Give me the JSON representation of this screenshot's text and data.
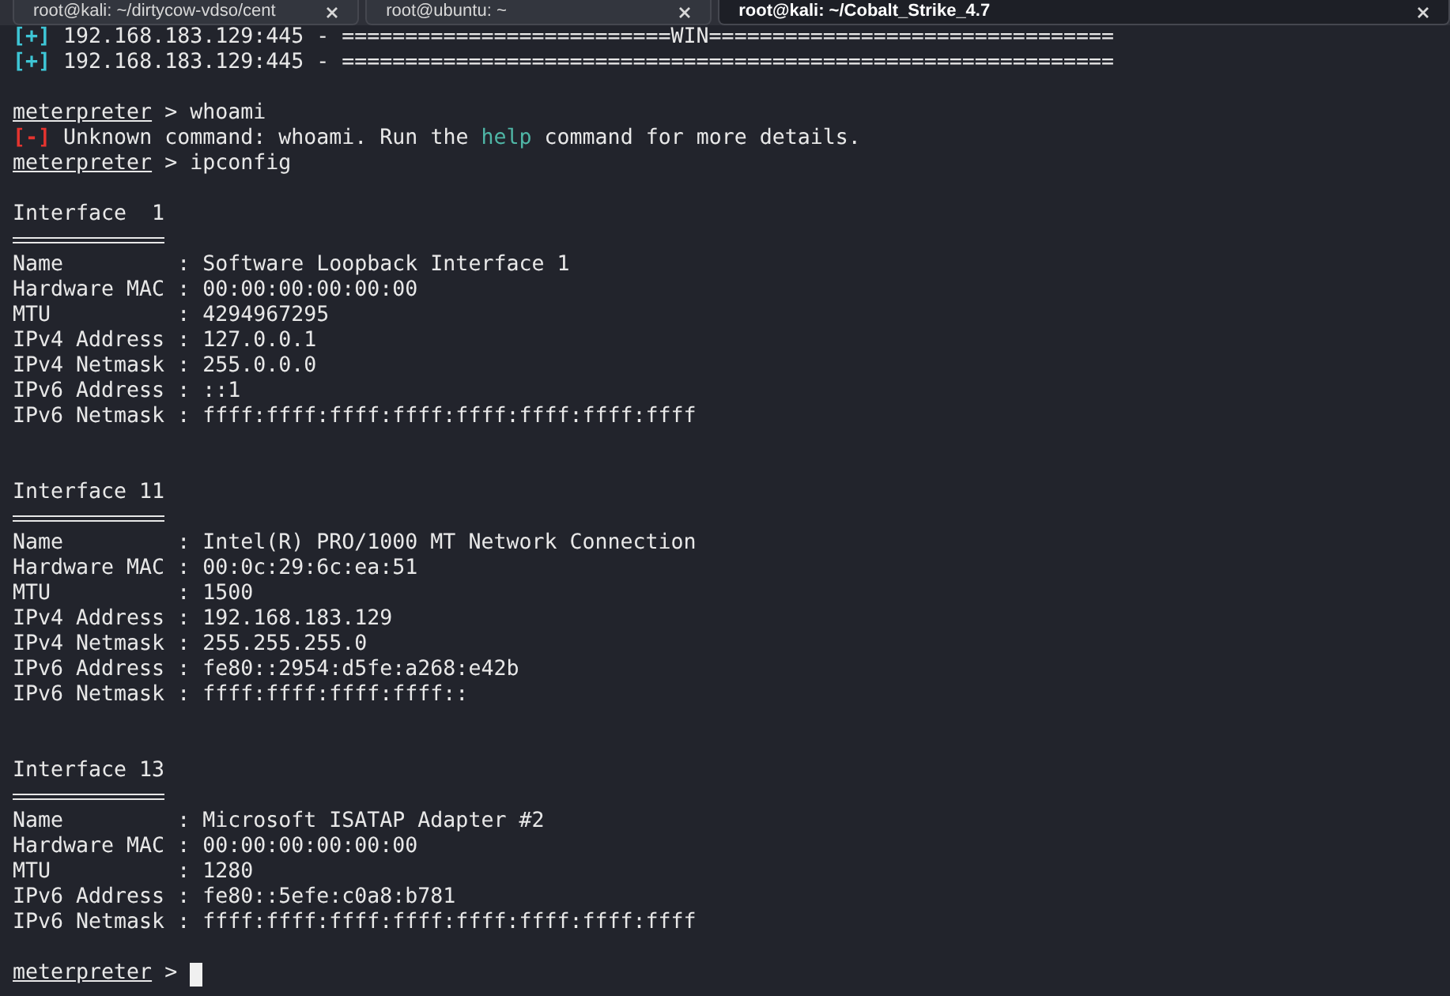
{
  "tabs": [
    {
      "title": "root@kali: ~/dirtycow-vdso/cent",
      "selected": false
    },
    {
      "title": "root@ubuntu: ~",
      "selected": false
    },
    {
      "title": "root@kali: ~/Cobalt_Strike_4.7",
      "selected": true
    }
  ],
  "lines": [
    {
      "kind": "status",
      "mark": "[+]",
      "text": "192.168.183.129:445 - ==========================WIN================================"
    },
    {
      "kind": "status",
      "mark": "[+]",
      "text": "192.168.183.129:445 - ============================================================="
    },
    {
      "kind": "blank"
    },
    {
      "kind": "prompt",
      "prompt": "meterpreter",
      "symbol": ">",
      "command": "whoami",
      "cursor": false
    },
    {
      "kind": "error",
      "mark": "[-]",
      "before": "Unknown command: whoami. Run the",
      "keyword": "help",
      "after": "command for more details."
    },
    {
      "kind": "prompt",
      "prompt": "meterpreter",
      "symbol": ">",
      "command": "ipconfig",
      "cursor": false
    },
    {
      "kind": "blank"
    },
    {
      "kind": "heading",
      "text": "Interface  1"
    },
    {
      "kind": "field",
      "label": "Name",
      "separator": ":",
      "value": "Software Loopback Interface 1"
    },
    {
      "kind": "field",
      "label": "Hardware MAC",
      "separator": ":",
      "value": "00:00:00:00:00:00"
    },
    {
      "kind": "field",
      "label": "MTU",
      "separator": ":",
      "value": "4294967295"
    },
    {
      "kind": "field",
      "label": "IPv4 Address",
      "separator": ":",
      "value": "127.0.0.1"
    },
    {
      "kind": "field",
      "label": "IPv4 Netmask",
      "separator": ":",
      "value": "255.0.0.0"
    },
    {
      "kind": "field",
      "label": "IPv6 Address",
      "separator": ":",
      "value": "::1"
    },
    {
      "kind": "field",
      "label": "IPv6 Netmask",
      "separator": ":",
      "value": "ffff:ffff:ffff:ffff:ffff:ffff:ffff:ffff"
    },
    {
      "kind": "blank"
    },
    {
      "kind": "blank"
    },
    {
      "kind": "heading",
      "text": "Interface 11"
    },
    {
      "kind": "field",
      "label": "Name",
      "separator": ":",
      "value": "Intel(R) PRO/1000 MT Network Connection"
    },
    {
      "kind": "field",
      "label": "Hardware MAC",
      "separator": ":",
      "value": "00:0c:29:6c:ea:51"
    },
    {
      "kind": "field",
      "label": "MTU",
      "separator": ":",
      "value": "1500"
    },
    {
      "kind": "field",
      "label": "IPv4 Address",
      "separator": ":",
      "value": "192.168.183.129"
    },
    {
      "kind": "field",
      "label": "IPv4 Netmask",
      "separator": ":",
      "value": "255.255.255.0"
    },
    {
      "kind": "field",
      "label": "IPv6 Address",
      "separator": ":",
      "value": "fe80::2954:d5fe:a268:e42b"
    },
    {
      "kind": "field",
      "label": "IPv6 Netmask",
      "separator": ":",
      "value": "ffff:ffff:ffff:ffff::"
    },
    {
      "kind": "blank"
    },
    {
      "kind": "blank"
    },
    {
      "kind": "heading",
      "text": "Interface 13"
    },
    {
      "kind": "field",
      "label": "Name",
      "separator": ":",
      "value": "Microsoft ISATAP Adapter #2"
    },
    {
      "kind": "field",
      "label": "Hardware MAC",
      "separator": ":",
      "value": "00:00:00:00:00:00"
    },
    {
      "kind": "field",
      "label": "MTU",
      "separator": ":",
      "value": "1280"
    },
    {
      "kind": "field",
      "label": "IPv6 Address",
      "separator": ":",
      "value": "fe80::5efe:c0a8:b781"
    },
    {
      "kind": "field",
      "label": "IPv6 Netmask",
      "separator": ":",
      "value": "ffff:ffff:ffff:ffff:ffff:ffff:ffff:ffff"
    },
    {
      "kind": "blank"
    },
    {
      "kind": "prompt",
      "prompt": "meterpreter",
      "symbol": ">",
      "cursor": true
    }
  ]
}
